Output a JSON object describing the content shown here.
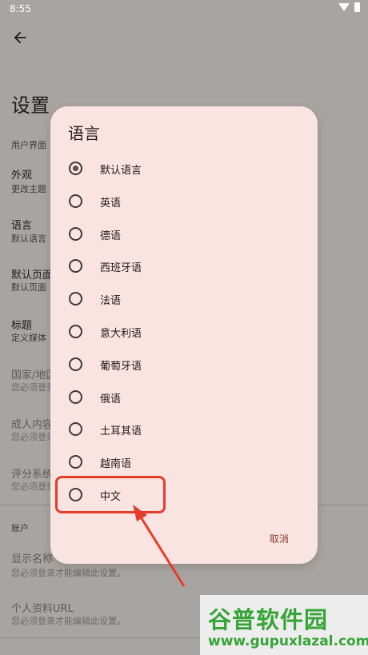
{
  "status": {
    "time": "8:55"
  },
  "page": {
    "title": "设置",
    "section_ui": "用户界面",
    "items": [
      {
        "title": "外观",
        "subtitle": "更改主题"
      },
      {
        "title": "语言",
        "subtitle": "默认语言"
      },
      {
        "title": "默认页面",
        "subtitle": "默认页面"
      },
      {
        "title": "标题",
        "subtitle": "定义媒体"
      },
      {
        "title": "国家/地区",
        "subtitle": "您必须登录"
      },
      {
        "title": "成人内容",
        "subtitle": "您必须登录"
      },
      {
        "title": "评分系统",
        "subtitle": "您必须登录"
      }
    ],
    "section_account": "账户",
    "account_items": [
      {
        "title": "显示名称",
        "subtitle": "您必须登录才能编辑此设置。"
      },
      {
        "title": "个人资料URL",
        "subtitle": "您必须登录才能编辑此设置。"
      }
    ]
  },
  "dialog": {
    "title": "语言",
    "options": [
      "默认语言",
      "英语",
      "德语",
      "西班牙语",
      "法语",
      "意大利语",
      "葡萄牙语",
      "俄语",
      "土耳其语",
      "越南语",
      "中文"
    ],
    "selected_index": 0,
    "cancel": "取消"
  },
  "annotation": {
    "color": "#e33d2c"
  },
  "watermark": {
    "name": "谷普软件园",
    "url": "www.gupuxlazal.com"
  }
}
